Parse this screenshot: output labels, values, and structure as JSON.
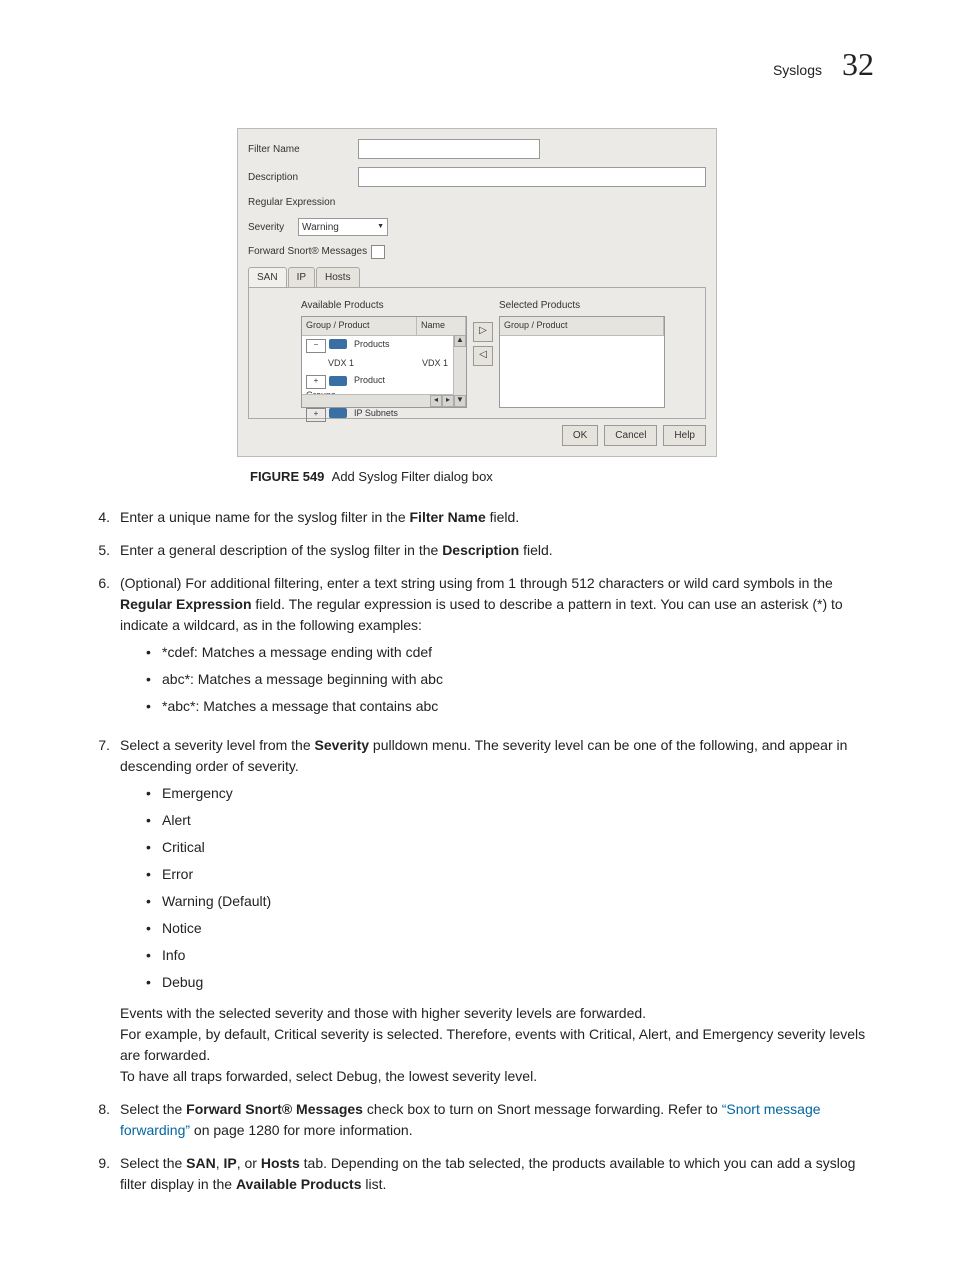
{
  "header": {
    "section": "Syslogs",
    "chapter": "32"
  },
  "dialog": {
    "labels": {
      "filter_name": "Filter Name",
      "description": "Description",
      "regex": "Regular Expression",
      "severity": "Severity",
      "forward": "Forward Snort® Messages"
    },
    "severity_value": "Warning",
    "tabs": [
      "SAN",
      "IP",
      "Hosts"
    ],
    "available_title": "Available Products",
    "selected_title": "Selected Products",
    "cols": {
      "gp": "Group / Product",
      "name": "Name"
    },
    "tree": {
      "root": "Products",
      "item": "VDX 1",
      "item_name": "VDX 1",
      "group2": "Product Groups",
      "group3": "IP Subnets"
    },
    "buttons": {
      "ok": "OK",
      "cancel": "Cancel",
      "help": "Help"
    }
  },
  "caption": {
    "fig": "FIGURE 549",
    "text": "Add Syslog Filter dialog box"
  },
  "steps": {
    "s4": {
      "n": "4.",
      "a": "Enter a unique name for the syslog filter in the ",
      "b": "Filter Name",
      "c": " field."
    },
    "s5": {
      "n": "5.",
      "a": "Enter a general description of the syslog filter in the ",
      "b": "Description",
      "c": " field."
    },
    "s6": {
      "n": "6.",
      "a": "(Optional) For additional filtering, enter a text string using from 1 through 512 characters or wild card symbols in the ",
      "b": "Regular Expression",
      "c": " field. The regular expression is used to describe a pattern in text. You can use an asterisk (*) to indicate a wildcard, as in the following examples:",
      "bullets": [
        "*cdef: Matches a message ending with cdef",
        "abc*: Matches a message beginning with abc",
        "*abc*: Matches a message that contains abc"
      ]
    },
    "s7": {
      "n": "7.",
      "a": "Select a severity level from the ",
      "b": "Severity",
      "c": " pulldown menu. The severity level can be one of the following, and appear in descending order of severity.",
      "bullets": [
        "Emergency",
        "Alert",
        "Critical",
        "Error",
        "Warning (Default)",
        "Notice",
        "Info",
        "Debug"
      ],
      "p1": "Events with the selected severity and those with higher severity levels are forwarded.",
      "p2": "For example, by default, Critical severity is selected. Therefore, events with Critical, Alert, and Emergency severity levels are forwarded.",
      "p3": "To have all traps forwarded, select Debug, the lowest severity level."
    },
    "s8": {
      "n": "8.",
      "a": "Select the ",
      "b": "Forward Snort® Messages",
      "c": " check box to turn on Snort message forwarding. Refer to ",
      "link": "“Snort message forwarding”",
      "d": " on page 1280 for more information."
    },
    "s9": {
      "n": "9.",
      "a": "Select the ",
      "b1": "SAN",
      "sep1": ", ",
      "b2": "IP",
      "sep2": ", or ",
      "b3": "Hosts",
      "c": " tab. Depending on the tab selected, the products available to which you can add a syslog filter display in the ",
      "d": "Available Products",
      "e": " list."
    }
  }
}
